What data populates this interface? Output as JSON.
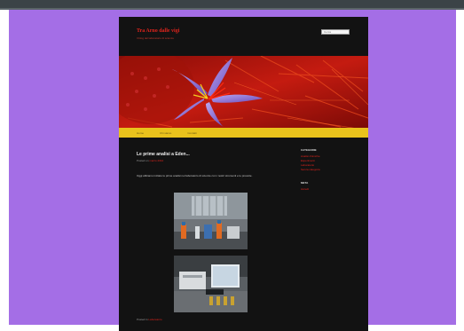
{
  "colors": {
    "background": "#a46ee6",
    "page": "#121212",
    "accent": "#e3241c",
    "nav": "#e9c21c"
  },
  "site": {
    "title": "Tra Arno dalle vigi",
    "description": "Il blog del laboratorio di scienze"
  },
  "search": {
    "placeholder": "Cerca"
  },
  "nav": {
    "items": [
      "Home",
      "Chi siamo",
      "Contatti"
    ]
  },
  "post": {
    "title": "Le prime analisi a Eden...",
    "meta_prefix": "Posted on",
    "date": "marzo 2012",
    "text": "Oggi abbiamo iniziato le prime analisi nel laboratorio di scienze con i nostri strumenti e le provette.",
    "footer_prefix": "Posted in",
    "category": "Laboratorio"
  },
  "sidebar": {
    "widget1_title": "CATEGORIE",
    "widget1_items": [
      "Analisi chimiche",
      "Esperimenti",
      "Laboratorio",
      "Senza categoria"
    ],
    "widget2_title": "META",
    "widget2_items": [
      "Accedi"
    ]
  },
  "icons": {
    "header": "saffron-flower-image",
    "photo1": "lab-bottles-photo",
    "photo2": "lab-computer-photo"
  }
}
